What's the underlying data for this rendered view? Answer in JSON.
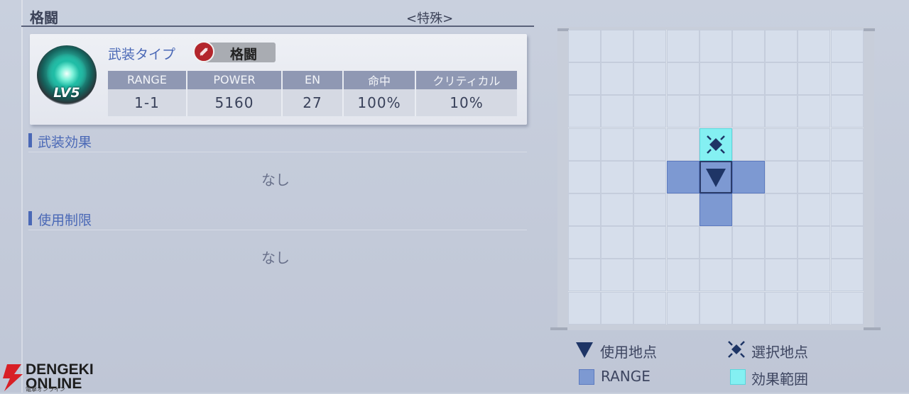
{
  "header": {
    "weapon_name": "格闘",
    "special_tag": "<特殊>"
  },
  "weapon_card": {
    "level_label": "LV5",
    "type_label": "武装タイプ",
    "type_value": "格闘",
    "type_icon": "melee-slash-icon",
    "stats": {
      "headers": [
        "RANGE",
        "POWER",
        "EN",
        "命中",
        "クリティカル"
      ],
      "values": [
        "1-1",
        "5160",
        "27",
        "100%",
        "10%"
      ]
    }
  },
  "sections": {
    "effect": {
      "title": "武装効果",
      "value": "なし"
    },
    "restriction": {
      "title": "使用制限",
      "value": "なし"
    }
  },
  "grid": {
    "columns": 9,
    "rows": 9,
    "use_point": [
      4,
      4
    ],
    "select_point": [
      4,
      3
    ],
    "range_cells": [
      [
        3,
        4
      ],
      [
        5,
        4
      ],
      [
        4,
        5
      ]
    ],
    "colors": {
      "range": "#7d99d2",
      "effect": "#84f0f2",
      "use_marker": "#1e3566"
    }
  },
  "legend": {
    "use_point": "使用地点",
    "select_point": "選択地点",
    "range": "RANGE",
    "effect_area": "効果範囲"
  },
  "watermark": {
    "brand": "DENGEKI",
    "brand2": "ONLINE",
    "sub": "電撃オンライン"
  }
}
